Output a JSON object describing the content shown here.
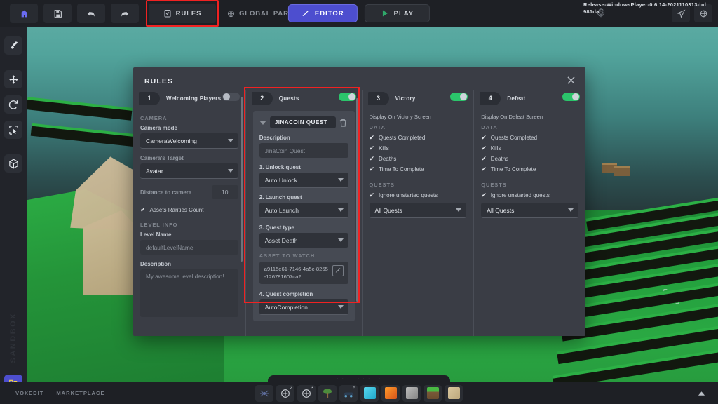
{
  "app": {
    "version": "Release-WindowsPlayer-0.6.14-2021110313-bd981da",
    "brand": "SANDBOX"
  },
  "topbar": {
    "home_icon": "home-icon",
    "save_icon": "save-icon",
    "undo_icon": "undo-icon",
    "redo_icon": "redo-icon",
    "rules_label": "RULES",
    "rules_icon": "clipboard-check-icon",
    "global_parameters_label": "GLOBAL PARAMETERS",
    "global_parameters_icon": "globe-icon",
    "editor_label": "EDITOR",
    "editor_icon": "pencil-icon",
    "play_label": "PLAY",
    "play_icon": "play-icon",
    "send_icon": "paper-plane-icon",
    "publish_icon": "globe-icon",
    "settings_icon": "gear-icon"
  },
  "sidebar": {
    "tools": [
      {
        "name": "paint-brush-tool",
        "icon": "paint-brush-icon"
      },
      {
        "name": "move-tool",
        "icon": "move-arrows-icon"
      },
      {
        "name": "rotate-tool",
        "icon": "rotate-icon"
      },
      {
        "name": "select-tool",
        "icon": "select-cursor-icon"
      },
      {
        "name": "block-tool",
        "icon": "cube-icon"
      }
    ],
    "bottom_button_icon": "list-blue-icon"
  },
  "bottombar": {
    "voxedit_label": "VOXEDIT",
    "marketplace_label": "MARKETPLACE",
    "collapse_icon": "chevron-up-icon",
    "hood_dots": "· · · · · · · · ·",
    "hotbar": [
      {
        "name": "slot-spider",
        "icon": "spider-icon",
        "sup": ""
      },
      {
        "name": "slot-spawn-2",
        "icon": "target-plus-icon",
        "sup": "2"
      },
      {
        "name": "slot-spawn-3",
        "icon": "target-plus-icon",
        "sup": "3"
      },
      {
        "name": "slot-tree",
        "icon": "tree-icon",
        "sup": ""
      },
      {
        "name": "slot-vehicle",
        "icon": "vehicle-icon",
        "sup": "5"
      },
      {
        "name": "slot-ice-block",
        "icon": "ice-cube-icon",
        "sup": ""
      },
      {
        "name": "slot-lava-block",
        "icon": "lava-cube-icon",
        "sup": ""
      },
      {
        "name": "slot-stone-block",
        "icon": "stone-cube-icon",
        "sup": ""
      },
      {
        "name": "slot-grass-block",
        "icon": "grass-cube-icon",
        "sup": ""
      },
      {
        "name": "slot-sand-block",
        "icon": "sand-cube-icon",
        "sup": ""
      }
    ]
  },
  "viewport": {
    "gizmo_label_1": "⌐",
    "gizmo_label_2": "⌐"
  },
  "modal": {
    "title": "RULES",
    "close_icon": "close-icon",
    "columns": [
      {
        "number": "1",
        "name": "Welcoming Players",
        "toggle_on": false,
        "sections": {
          "camera_label": "CAMERA",
          "camera_mode_label": "Camera mode",
          "camera_mode_value": "CameraWelcoming",
          "camera_target_label": "Camera's Target",
          "camera_target_value": "Avatar",
          "distance_label": "Distance to camera",
          "distance_value": "10",
          "assets_rarities_label": "Assets Rarities Count",
          "assets_rarities_checked": true,
          "level_info_label": "LEVEL INFO",
          "level_name_label": "Level Name",
          "level_name_value": "defaultLevelName",
          "description_label": "Description",
          "description_value": "My awesome level description!"
        }
      },
      {
        "number": "2",
        "name": "Quests",
        "toggle_on": true,
        "highlighted": true,
        "quest": {
          "name_value": "JINACOIN QUEST",
          "collapse_icon": "caret-down-icon",
          "delete_icon": "trash-icon",
          "description_label": "Description",
          "description_value": "JinaCoin Quest",
          "step1_label": "1. Unlock quest",
          "step1_value": "Auto Unlock",
          "step2_label": "2. Launch quest",
          "step2_value": "Auto Launch",
          "step3_label": "3. Quest type",
          "step3_value": "Asset Death",
          "asset_to_watch_label": "ASSET TO WATCH",
          "asset_to_watch_value": "a9115e61-7146-4a5c-8255-126781607ca2",
          "asset_edit_icon": "pencil-square-icon",
          "step4_label": "4. Quest completion",
          "step4_value": "AutoCompletion"
        }
      },
      {
        "number": "3",
        "name": "Victory",
        "toggle_on": true,
        "display_label": "Display On Victory Screen",
        "data_label": "DATA",
        "data_items": [
          {
            "label": "Quests Completed",
            "checked": true
          },
          {
            "label": "Kills",
            "checked": true
          },
          {
            "label": "Deaths",
            "checked": true
          },
          {
            "label": "Time To Complete",
            "checked": true
          }
        ],
        "quests_label": "QUESTS",
        "ignore_label": "Ignore unstarted quests",
        "ignore_checked": true,
        "quests_select_value": "All Quests"
      },
      {
        "number": "4",
        "name": "Defeat",
        "toggle_on": true,
        "display_label": "Display On Defeat Screen",
        "data_label": "DATA",
        "data_items": [
          {
            "label": "Quests Completed",
            "checked": true
          },
          {
            "label": "Kills",
            "checked": true
          },
          {
            "label": "Deaths",
            "checked": true
          },
          {
            "label": "Time To Complete",
            "checked": true
          }
        ],
        "quests_label": "QUESTS",
        "ignore_label": "Ignore unstarted quests",
        "ignore_checked": true,
        "quests_select_value": "All Quests"
      }
    ]
  },
  "colors": {
    "accent_blue": "#4d4ecf",
    "toggle_on": "#2bc56b",
    "highlight_red": "#f02222",
    "panel_bg": "#3a3d45",
    "chrome_bg": "#1e2025"
  }
}
